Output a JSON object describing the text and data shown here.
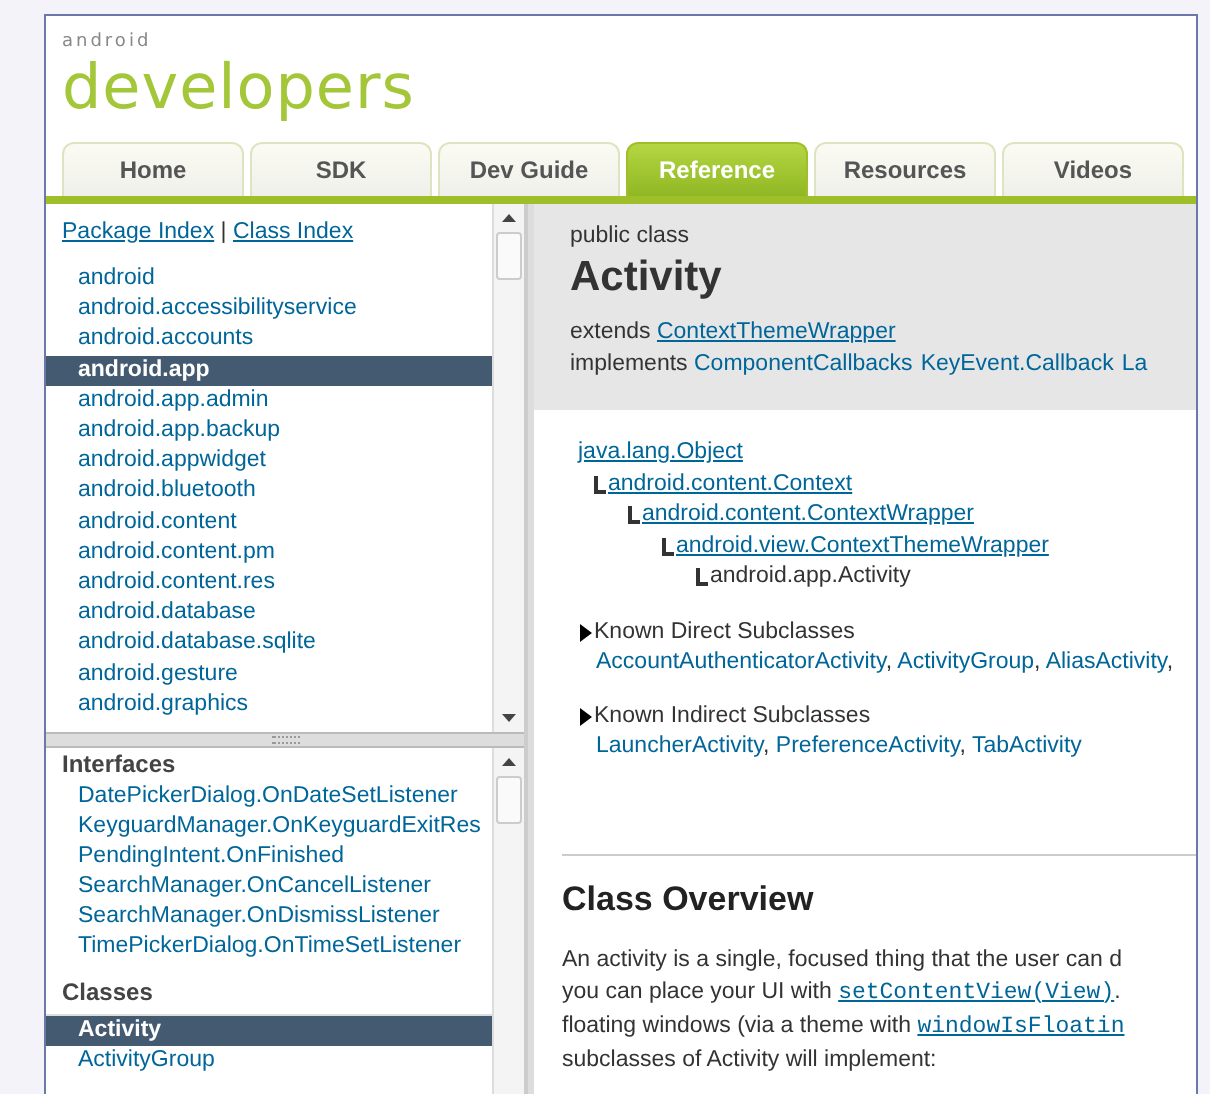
{
  "logo": {
    "small": "android",
    "large": "developers"
  },
  "tabs": [
    {
      "label": "Home",
      "selected": false
    },
    {
      "label": "SDK",
      "selected": false
    },
    {
      "label": "Dev Guide",
      "selected": false
    },
    {
      "label": "Reference",
      "selected": true
    },
    {
      "label": "Resources",
      "selected": false
    },
    {
      "label": "Videos",
      "selected": false
    }
  ],
  "sidebar": {
    "index_links": [
      "Package Index",
      "Class Index"
    ],
    "index_separator": "|",
    "packages": [
      {
        "label": "android",
        "selected": false
      },
      {
        "label": "android.accessibilityservice",
        "selected": false
      },
      {
        "label": "android.accounts",
        "selected": false
      },
      {
        "label": "android.app",
        "selected": true
      },
      {
        "label": "android.app.admin",
        "selected": false
      },
      {
        "label": "android.app.backup",
        "selected": false
      },
      {
        "label": "android.appwidget",
        "selected": false
      },
      {
        "label": "android.bluetooth",
        "selected": false
      },
      {
        "label": "android.content",
        "selected": false
      },
      {
        "label": "android.content.pm",
        "selected": false
      },
      {
        "label": "android.content.res",
        "selected": false
      },
      {
        "label": "android.database",
        "selected": false
      },
      {
        "label": "android.database.sqlite",
        "selected": false
      },
      {
        "label": "android.gesture",
        "selected": false
      },
      {
        "label": "android.graphics",
        "selected": false
      }
    ],
    "sections": [
      {
        "heading": "Interfaces",
        "items": [
          {
            "label": "DatePickerDialog.OnDateSetListener",
            "selected": false
          },
          {
            "label": "KeyguardManager.OnKeyguardExitRes",
            "selected": false
          },
          {
            "label": "PendingIntent.OnFinished",
            "selected": false
          },
          {
            "label": "SearchManager.OnCancelListener",
            "selected": false
          },
          {
            "label": "SearchManager.OnDismissListener",
            "selected": false
          },
          {
            "label": "TimePickerDialog.OnTimeSetListener",
            "selected": false
          }
        ]
      },
      {
        "heading": "Classes",
        "items": [
          {
            "label": "Activity",
            "selected": true
          },
          {
            "label": "ActivityGroup",
            "selected": false
          }
        ]
      }
    ]
  },
  "content": {
    "modifier": "public class",
    "title": "Activity",
    "extends_label": "extends",
    "extends": "ContextThemeWrapper",
    "implements_label": "implements",
    "implements": [
      "ComponentCallbacks",
      "KeyEvent.Callback",
      "La"
    ],
    "hierarchy": {
      "label": "java.lang.Object",
      "link": true,
      "children": [
        {
          "label": "android.content.Context",
          "link": true,
          "children": [
            {
              "label": "android.content.ContextWrapper",
              "link": true,
              "children": [
                {
                  "label": "android.view.ContextThemeWrapper",
                  "link": true,
                  "children": [
                    {
                      "label": "android.app.Activity",
                      "link": false
                    }
                  ]
                }
              ]
            }
          ]
        }
      ]
    },
    "subclasses": [
      {
        "label": "Known Direct Subclasses",
        "items": [
          {
            "text": "AccountAuthenticatorActivity",
            "sep": ","
          },
          {
            "text": "ActivityGroup",
            "sep": ","
          },
          {
            "text": "AliasActivity",
            "sep": ","
          }
        ]
      },
      {
        "label": "Known Indirect Subclasses",
        "items": [
          {
            "text": "LauncherActivity",
            "sep": ","
          },
          {
            "text": "PreferenceActivity",
            "sep": ","
          },
          {
            "text": "TabActivity"
          }
        ]
      }
    ],
    "overview_heading": "Class Overview",
    "overview_lines": [
      [
        {
          "kind": "text",
          "text": "An activity is a single, focused thing that the user can d"
        }
      ],
      [
        {
          "kind": "text",
          "text": "you can place your UI with "
        },
        {
          "kind": "code",
          "text": "setContentView(View)"
        },
        {
          "kind": "text",
          "text": "."
        }
      ],
      [
        {
          "kind": "text",
          "text": "floating windows (via a theme with "
        },
        {
          "kind": "code",
          "text": "windowIsFloatin"
        }
      ],
      [
        {
          "kind": "text",
          "text": "subclasses of Activity will implement:"
        }
      ]
    ]
  }
}
